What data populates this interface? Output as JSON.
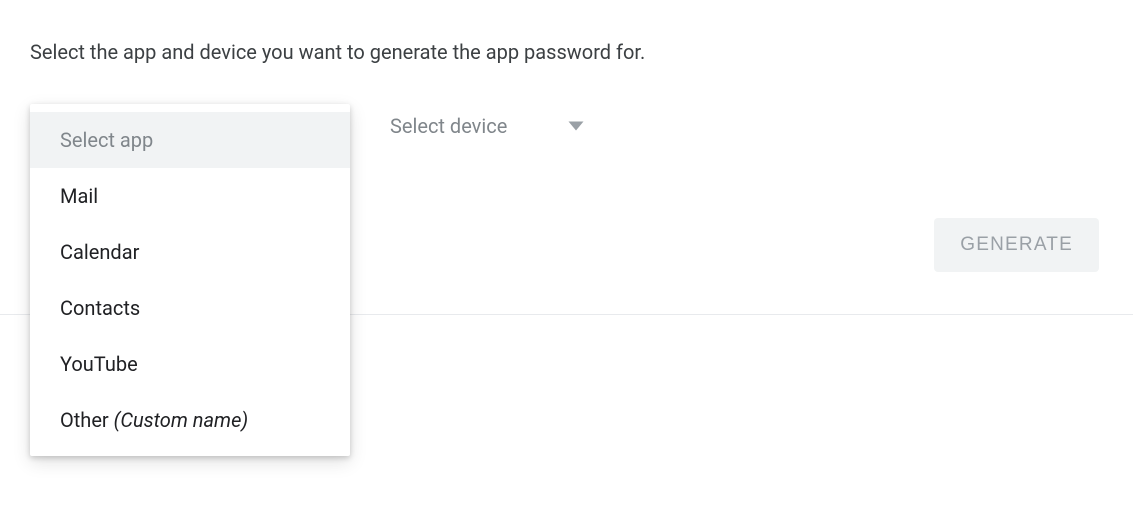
{
  "instruction": "Select the app and device you want to generate the app password for.",
  "app_select": {
    "placeholder": "Select app",
    "options": [
      {
        "label": "Mail"
      },
      {
        "label": "Calendar"
      },
      {
        "label": "Contacts"
      },
      {
        "label": "YouTube"
      },
      {
        "label": "Other ",
        "suffix": "(Custom name)"
      }
    ]
  },
  "device_select": {
    "placeholder": "Select device"
  },
  "generate_button": "GENERATE"
}
